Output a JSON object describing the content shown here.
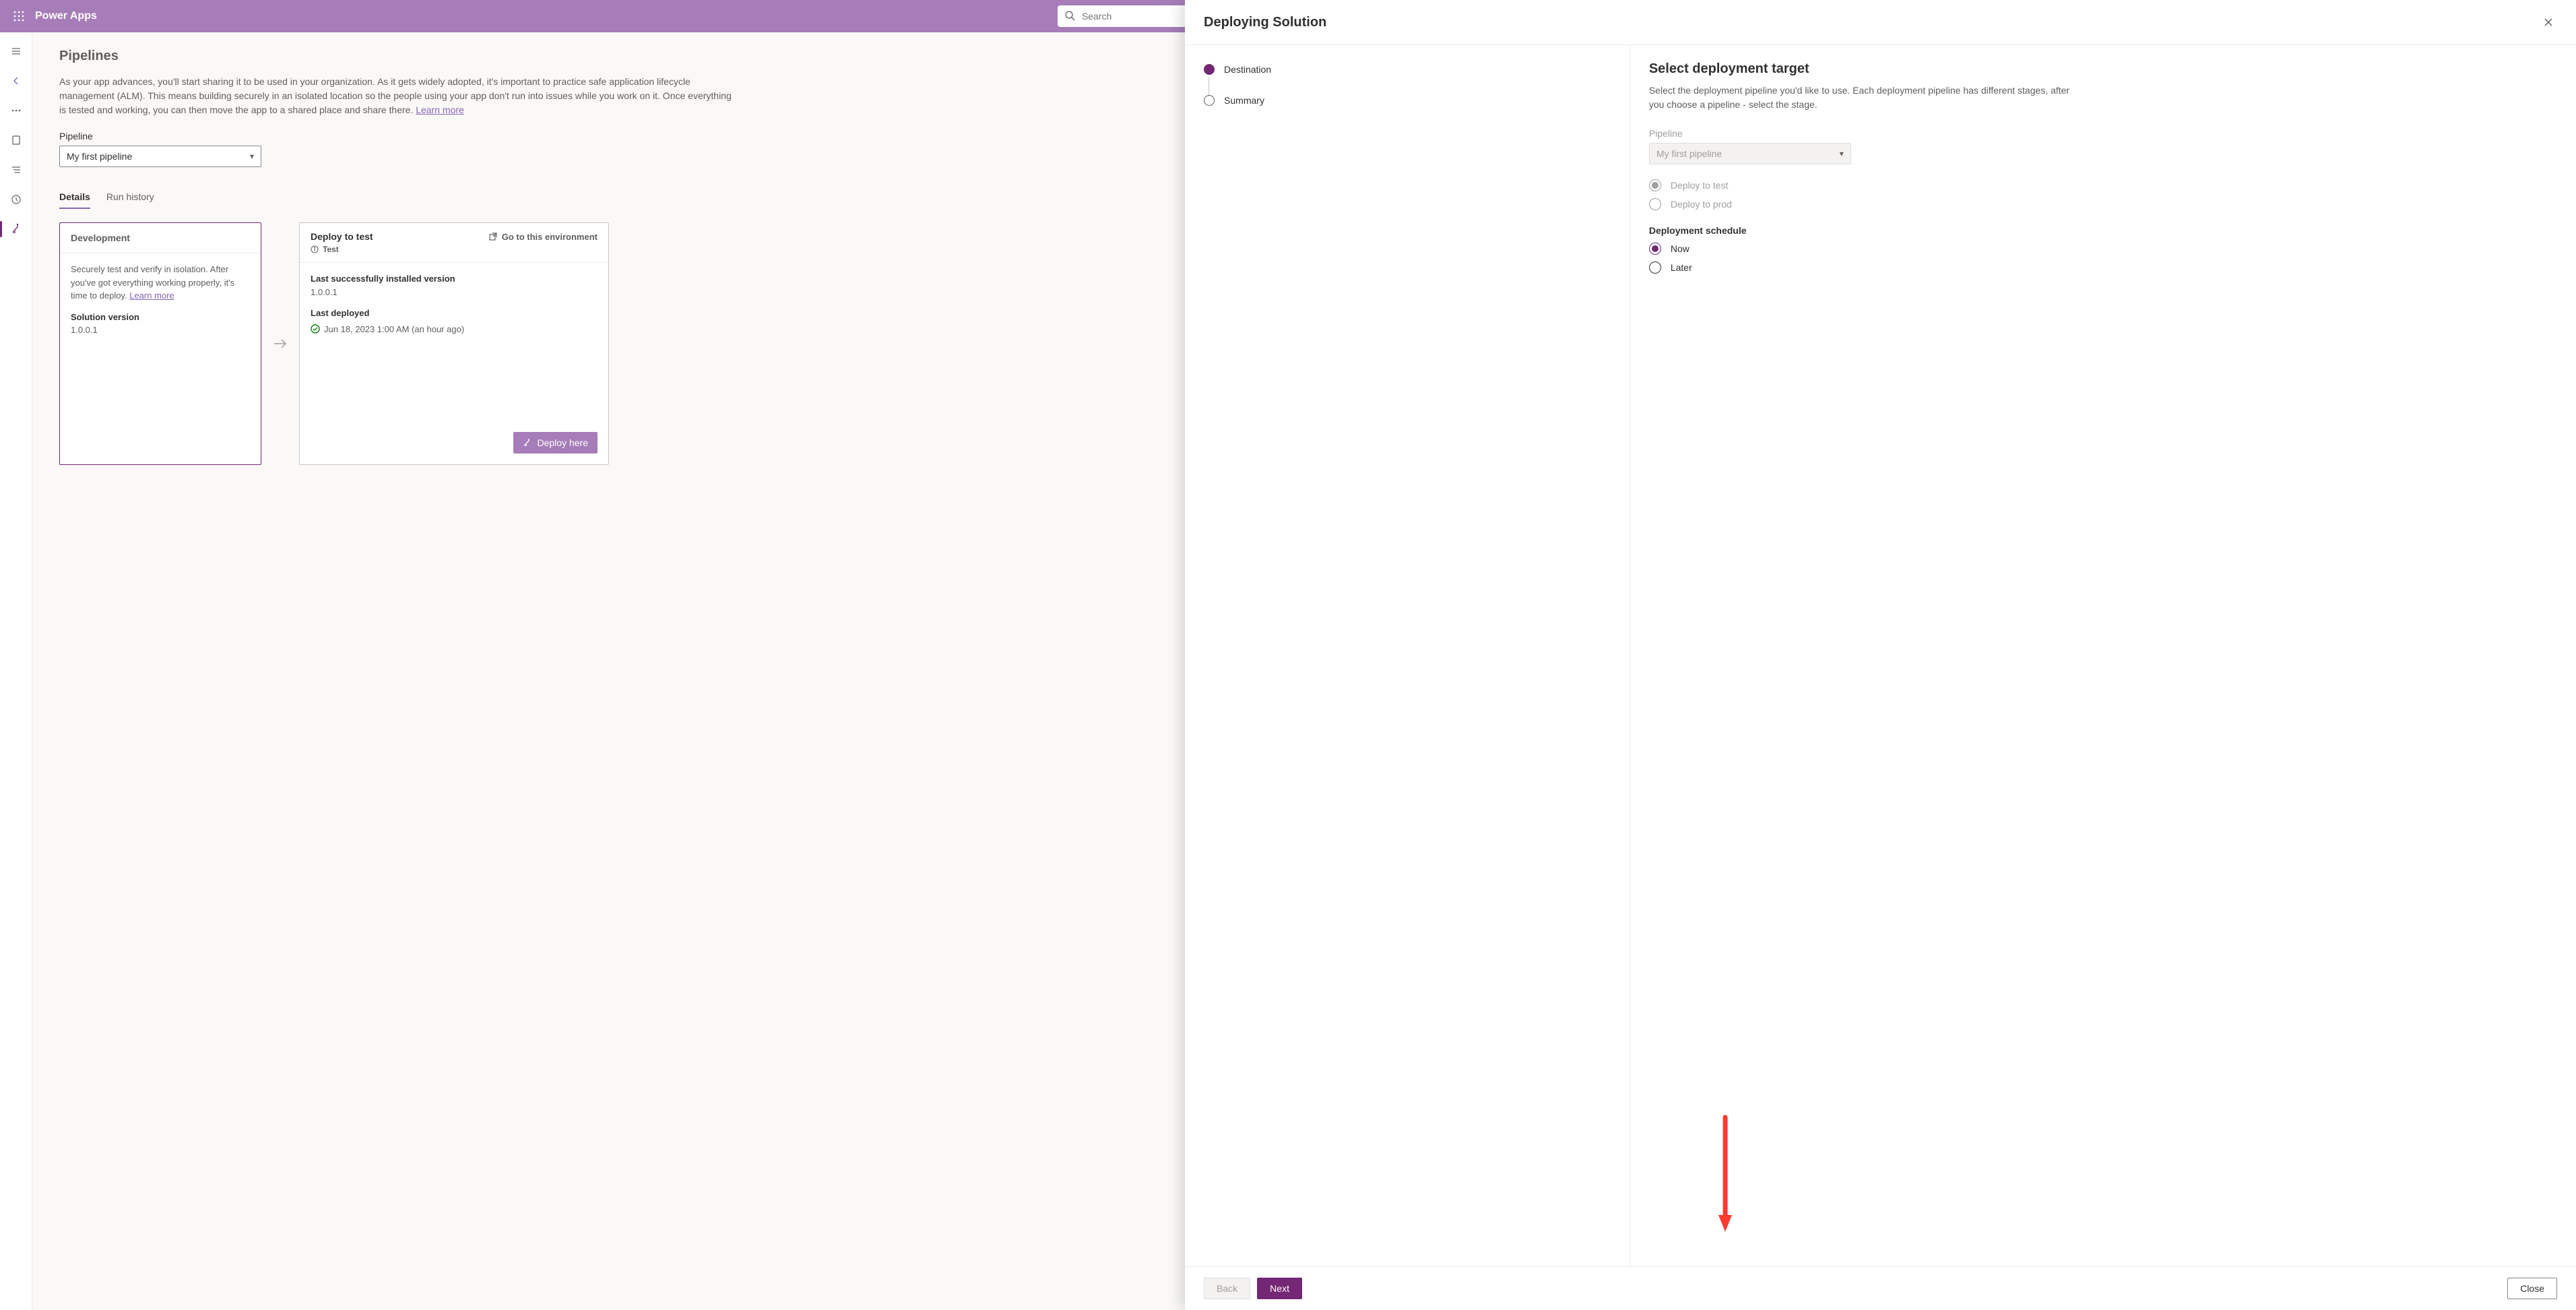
{
  "header": {
    "brand": "Power Apps",
    "search_placeholder": "Search"
  },
  "page": {
    "title": "Pipelines",
    "intro": "As your app advances, you'll start sharing it to be used in your organization. As it gets widely adopted, it's important to practice safe application lifecycle management (ALM). This means building securely in an isolated location so the people using your app don't run into issues while you work on it. Once everything is tested and working, you can then move the app to a shared place and share there.",
    "learn_more": "Learn more",
    "pipeline_label": "Pipeline",
    "pipeline_value": "My first pipeline",
    "tabs": {
      "details": "Details",
      "run_history": "Run history"
    }
  },
  "dev_card": {
    "title": "Development",
    "body": "Securely test and verify in isolation. After you've got everything working properly, it's time to deploy.",
    "learn_more": "Learn more",
    "sol_label": "Solution version",
    "sol_value": "1.0.0.1"
  },
  "test_card": {
    "title": "Deploy to test",
    "go_env": "Go to this environment",
    "env_name": "Test",
    "last_installed_label": "Last successfully installed version",
    "last_installed_value": "1.0.0.1",
    "last_deployed_label": "Last deployed",
    "last_deployed_value": "Jun 18, 2023 1:00 AM (an hour ago)",
    "deploy_btn": "Deploy here"
  },
  "panel": {
    "title": "Deploying Solution",
    "nav": {
      "step1": "Destination",
      "step2": "Summary"
    },
    "content": {
      "heading": "Select deployment target",
      "desc": "Select the deployment pipeline you'd like to use. Each deployment pipeline has different stages, after you choose a pipeline - select the stage.",
      "pipeline_label": "Pipeline",
      "pipeline_value": "My first pipeline",
      "opt_test": "Deploy to test",
      "opt_prod": "Deploy to prod",
      "schedule_label": "Deployment schedule",
      "sched_now": "Now",
      "sched_later": "Later"
    },
    "footer": {
      "back": "Back",
      "next": "Next",
      "close": "Close"
    }
  }
}
